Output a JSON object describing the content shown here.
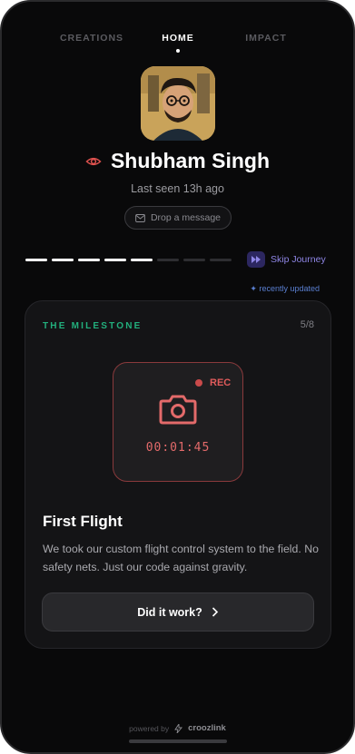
{
  "tabs": [
    {
      "label": "CREATIONS",
      "active": false
    },
    {
      "label": "HOME",
      "active": true
    },
    {
      "label": "IMPACT",
      "active": false
    }
  ],
  "profile": {
    "name": "Shubham Singh",
    "last_seen": "Last seen 13h ago",
    "message_button": "Drop a message"
  },
  "journey": {
    "progress_done": 5,
    "progress_total": 8,
    "skip_label": "Skip Journey",
    "recent_label": "✦ recently updated"
  },
  "card": {
    "label": "THE MILESTONE",
    "count": "5/8",
    "rec_label": "REC",
    "timer": "00:01:45",
    "title": "First Flight",
    "description": "We took our custom flight control system to the field. No safety nets. Just our code against gravity.",
    "cta": "Did it work?"
  },
  "footer": {
    "powered_by": "powered by",
    "brand": "croozlink"
  },
  "colors": {
    "accent_green": "#22b07d",
    "rec_red": "#e05b5b",
    "skip_purple": "#8f86e6",
    "link_blue": "#5a7fd0"
  }
}
